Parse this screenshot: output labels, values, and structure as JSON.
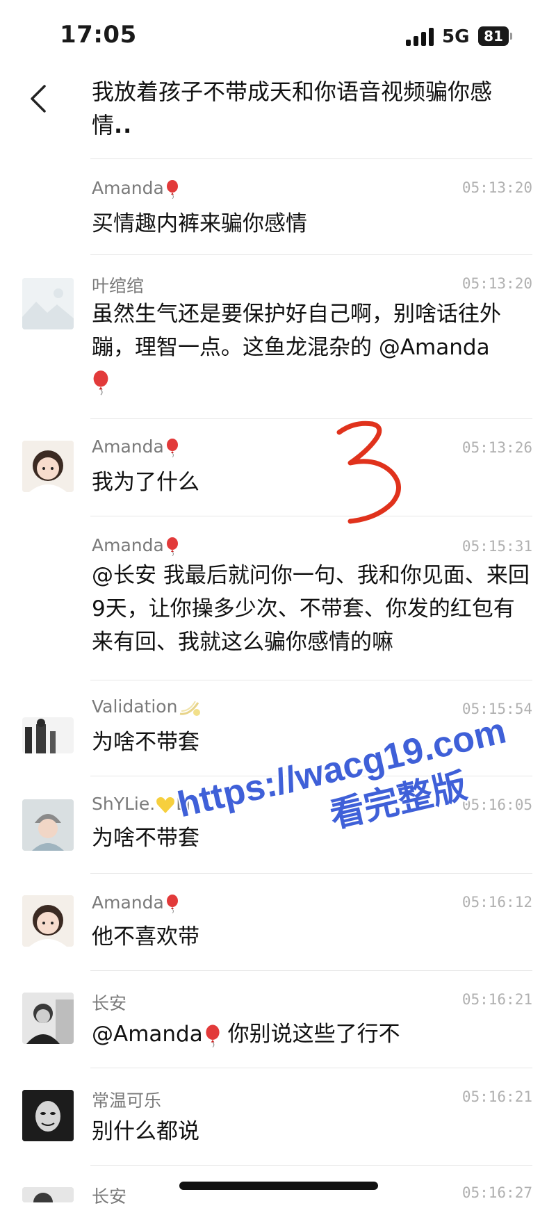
{
  "status_bar": {
    "time": "17:05",
    "network": "5G",
    "battery": "81"
  },
  "top_message": {
    "text": "我放着孩子不带成天和你语音视频骗你感情"
  },
  "messages": [
    {
      "name": "Amanda",
      "name_emoji": "balloon-icon",
      "time": "05:13:20",
      "text": "买情趣内裤来骗你感情"
    },
    {
      "name": "叶绾绾",
      "time": "05:13:20",
      "text": "虽然生气还是要保护好自己啊，别啥话往外蹦，理智一点。这鱼龙混杂的 @Amanda"
    },
    {
      "name": "Amanda",
      "name_emoji": "balloon-icon",
      "time": "05:13:26",
      "text": "我为了什么"
    },
    {
      "name": "Amanda",
      "name_emoji": "balloon-icon",
      "time": "05:15:31",
      "text": "@长安 我最后就问你一句、我和你见面、来回9天，让你操多少次、不带套、你发的红包有来有回、我就这么骗你感情的嘛"
    },
    {
      "name": "Validation",
      "name_emoji": "comet-icon",
      "time": "05:15:54",
      "text": "为啥不带套"
    },
    {
      "name_prefix": "ShYLie.",
      "name_suffix": "Li",
      "name_emoji": "yellow-heart-icon",
      "time": "05:16:05",
      "text": "为啥不带套"
    },
    {
      "name": "Amanda",
      "name_emoji": "balloon-icon",
      "time": "05:16:12",
      "text": "他不喜欢带"
    },
    {
      "name": "长安",
      "time": "05:16:21",
      "text_prefix": "@Amanda",
      "text_suffix": " 你别说这些了行不"
    },
    {
      "name": "常温可乐",
      "time": "05:16:21",
      "text": "别什么都说"
    },
    {
      "name": "长安",
      "time": "05:16:27"
    }
  ],
  "watermark": {
    "url": "https://wacg19.com",
    "caption": "看完整版"
  },
  "colors": {
    "watermark": "#3f60d8",
    "annotation": "#e0321c",
    "name": "#7a7a7a",
    "time": "#b0b0b0"
  }
}
